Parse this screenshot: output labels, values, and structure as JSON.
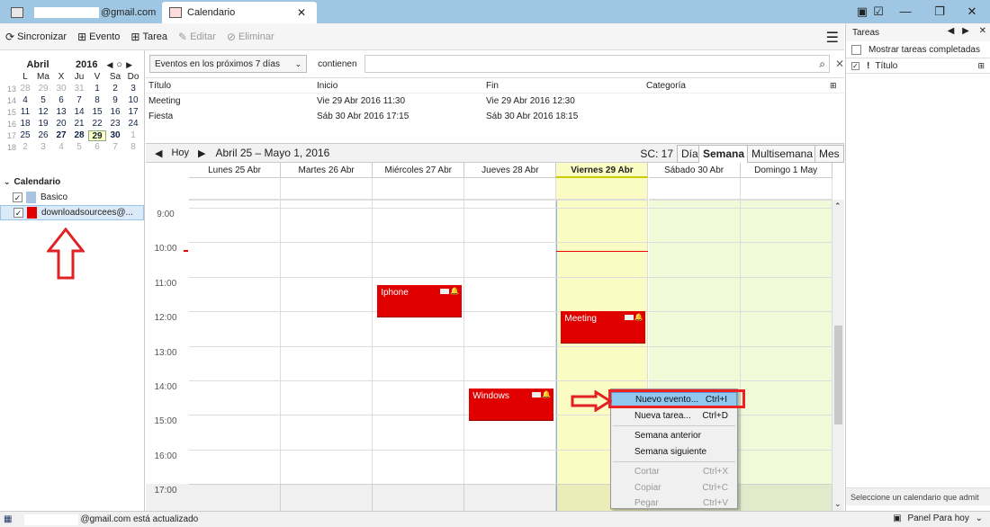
{
  "window": {
    "mail_tab_label": "@gmail.com",
    "calendar_tab_label": "Calendario",
    "close_tab": "✕",
    "minimize": "—",
    "restore": "❐",
    "close": "✕"
  },
  "toolbar": {
    "sync": "Sincronizar",
    "event": "Evento",
    "task": "Tarea",
    "edit": "Editar",
    "delete": "Eliminar"
  },
  "minical": {
    "month": "Abril",
    "year": "2016",
    "day_headers": [
      "L",
      "Ma",
      "X",
      "Ju",
      "V",
      "Sa",
      "Do"
    ],
    "weeks": [
      {
        "wk": "13",
        "days": [
          "28",
          "29",
          "30",
          "31",
          "1",
          "2",
          "3"
        ]
      },
      {
        "wk": "14",
        "days": [
          "4",
          "5",
          "6",
          "7",
          "8",
          "9",
          "10"
        ]
      },
      {
        "wk": "15",
        "days": [
          "11",
          "12",
          "13",
          "14",
          "15",
          "16",
          "17"
        ]
      },
      {
        "wk": "16",
        "days": [
          "18",
          "19",
          "20",
          "21",
          "22",
          "23",
          "24"
        ]
      },
      {
        "wk": "17",
        "days": [
          "25",
          "26",
          "27",
          "28",
          "29",
          "30",
          "1"
        ]
      },
      {
        "wk": "18",
        "days": [
          "2",
          "3",
          "4",
          "5",
          "6",
          "7",
          "8"
        ]
      }
    ]
  },
  "calendars": {
    "header": "Calendario",
    "items": [
      {
        "name": "Basico",
        "color": "#a8c4e0"
      },
      {
        "name": "downloadsourcees@...",
        "color": "#e00000"
      }
    ]
  },
  "filter": {
    "range": "Eventos en los próximos 7 días",
    "contains": "contienen",
    "value": ""
  },
  "eventlist": {
    "headers": [
      "Título",
      "Inicio",
      "Fin",
      "Categoría"
    ],
    "rows": [
      [
        "Meeting",
        "Vie 29 Abr 2016 11:30",
        "Vie 29 Abr 2016 12:30",
        ""
      ],
      [
        "Fiesta",
        "Sáb 30 Abr 2016 17:15",
        "Sáb 30 Abr 2016 18:15",
        ""
      ]
    ]
  },
  "nav": {
    "today": "Hoy",
    "range": "Abril 25 – Mayo 1, 2016",
    "week_number": "SC: 17",
    "views": [
      "Día",
      "Semana",
      "Multisemana",
      "Mes"
    ],
    "selected_view": "Semana"
  },
  "week": {
    "days": [
      "Lunes 25 Abr",
      "Martes 26 Abr",
      "Miércoles 27 Abr",
      "Jueves 28 Abr",
      "Viernes 29 Abr",
      "Sábado 30 Abr",
      "Domingo 1 May"
    ],
    "hours": [
      "9:00",
      "10:00",
      "11:00",
      "12:00",
      "13:00",
      "14:00",
      "15:00",
      "16:00",
      "17:00"
    ],
    "events": [
      {
        "title": "Iphone",
        "day": 2,
        "start": 11.5,
        "color": "#e00000"
      },
      {
        "title": "Meeting",
        "day": 4,
        "start": 12.25,
        "color": "#e00000"
      },
      {
        "title": "Windows",
        "day": 3,
        "start": 14.5,
        "color": "#e00000"
      }
    ]
  },
  "contextmenu": {
    "items": [
      {
        "label": "Nuevo evento...",
        "shortcut": "Ctrl+I",
        "highlight": true,
        "disabled": false
      },
      {
        "label": "Nueva tarea...",
        "shortcut": "Ctrl+D",
        "highlight": false,
        "disabled": false
      },
      {
        "label": "Semana anterior",
        "shortcut": "",
        "highlight": false,
        "disabled": false
      },
      {
        "label": "Semana siguiente",
        "shortcut": "",
        "highlight": false,
        "disabled": false
      },
      {
        "label": "Cortar",
        "shortcut": "Ctrl+X",
        "highlight": false,
        "disabled": true
      },
      {
        "label": "Copiar",
        "shortcut": "Ctrl+C",
        "highlight": false,
        "disabled": true
      },
      {
        "label": "Pegar",
        "shortcut": "Ctrl+V",
        "highlight": false,
        "disabled": true
      }
    ]
  },
  "tasks": {
    "header": "Tareas",
    "show_completed": "Mostrar tareas completadas",
    "column_title": "Título",
    "footer": "Seleccione un calendario que admit"
  },
  "status": {
    "text": "@gmail.com está actualizado",
    "today_pane": "Panel Para hoy"
  },
  "colors": {
    "event_red": "#e00000",
    "annotation_red": "#e22222",
    "today_column": "#fbfbc4",
    "weekend_column": "#f0fad8"
  }
}
